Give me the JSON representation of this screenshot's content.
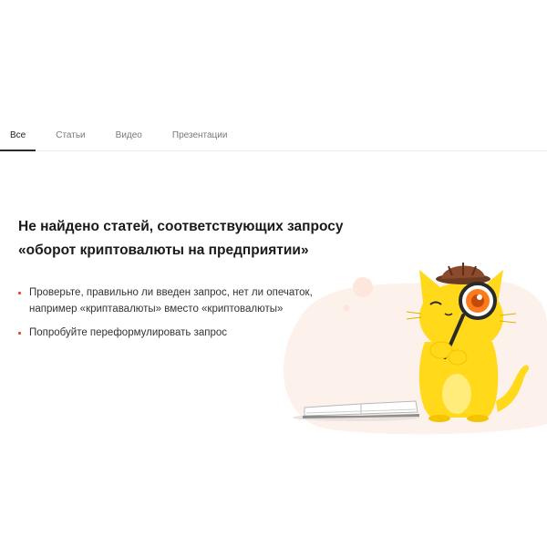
{
  "tabs": [
    {
      "label": "Все",
      "active": true
    },
    {
      "label": "Статьи",
      "active": false
    },
    {
      "label": "Видео",
      "active": false
    },
    {
      "label": "Презентации",
      "active": false
    }
  ],
  "empty_state": {
    "title_line1": "Не найдено статей, соответствующих запросу",
    "title_line2": "«оборот криптовалюты на предприятии»",
    "tips": [
      {
        "line1": "Проверьте, правильно ли введен запрос, нет ли опечаток,",
        "line2": "например «криптавалюты» вместо «криптовалюты»"
      },
      {
        "line1": "Попробуйте переформулировать запрос",
        "line2": ""
      }
    ],
    "illustration": "detective-cat-with-magnifier-and-book"
  },
  "colors": {
    "accent_bullet": "#e8462f",
    "cat_yellow": "#ffd91a",
    "blob_peach": "#fdf1ec"
  }
}
